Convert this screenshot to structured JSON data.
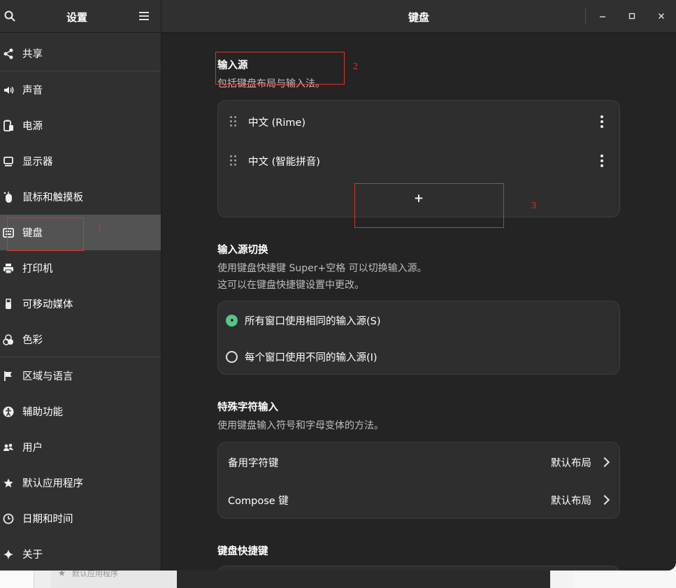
{
  "sidebar": {
    "title": "设置",
    "items": [
      {
        "label": "共享",
        "icon": "share-icon"
      },
      {
        "label": "声音",
        "icon": "speaker-icon"
      },
      {
        "label": "电源",
        "icon": "power-icon"
      },
      {
        "label": "显示器",
        "icon": "display-icon"
      },
      {
        "label": "鼠标和触摸板",
        "icon": "mouse-icon"
      },
      {
        "label": "键盘",
        "icon": "keyboard-icon"
      },
      {
        "label": "打印机",
        "icon": "printer-icon"
      },
      {
        "label": "可移动媒体",
        "icon": "usb-icon"
      },
      {
        "label": "色彩",
        "icon": "color-icon"
      },
      {
        "label": "区域与语言",
        "icon": "flag-icon"
      },
      {
        "label": "辅助功能",
        "icon": "accessibility-icon"
      },
      {
        "label": "用户",
        "icon": "users-icon"
      },
      {
        "label": "默认应用程序",
        "icon": "star-icon"
      },
      {
        "label": "日期和时间",
        "icon": "clock-icon"
      },
      {
        "label": "关于",
        "icon": "sparkle-icon"
      }
    ],
    "active": "键盘"
  },
  "header": {
    "title": "键盘"
  },
  "input_sources": {
    "title": "输入源",
    "desc": "包括键盘布局与输入法。",
    "items": [
      {
        "label": "中文 (Rime)"
      },
      {
        "label": "中文 (智能拼音)"
      }
    ],
    "add_label": "+"
  },
  "switching": {
    "title": "输入源切换",
    "desc1": "使用键盘快捷键 Super+空格 可以切换输入源。",
    "desc2": "这可以在键盘快捷键设置中更改。",
    "options": [
      {
        "label": "所有窗口使用相同的输入源(S)",
        "selected": true
      },
      {
        "label": "每个窗口使用不同的输入源(I)",
        "selected": false
      }
    ]
  },
  "special_chars": {
    "title": "特殊字符输入",
    "desc": "使用键盘输入符号和字母变体的方法。",
    "rows": [
      {
        "label": "备用字符键",
        "value": "默认布局"
      },
      {
        "label": "Compose 键",
        "value": "默认布局"
      }
    ]
  },
  "shortcuts": {
    "title": "键盘快捷键"
  },
  "annotations": {
    "n1": "1",
    "n2": "2",
    "n3": "3",
    "color": "#e0302f"
  },
  "background": {
    "label": "默认应用程序"
  },
  "colors": {
    "accent": "#57c48c",
    "sidebar_bg": "#303030",
    "content_bg": "#242424",
    "card_bg": "#2e2e2e",
    "active_bg": "#535353"
  }
}
